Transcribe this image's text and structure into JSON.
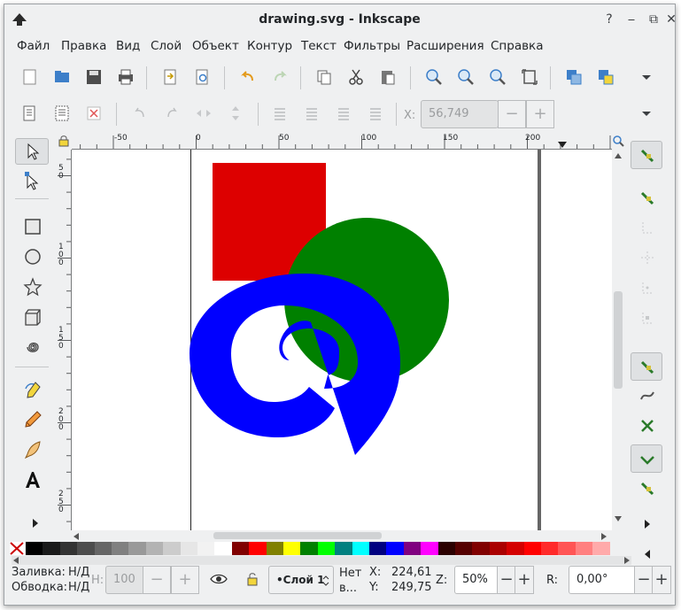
{
  "window": {
    "title": "drawing.svg - Inkscape"
  },
  "menu": [
    "Файл",
    "Правка",
    "Вид",
    "Слой",
    "Объект",
    "Контур",
    "Текст",
    "Фильтры",
    "Расширения",
    "Справка"
  ],
  "toolbar2": {
    "x_label": "X:",
    "x_value": "56,749",
    "minus": "−",
    "plus": "+"
  },
  "ruler": {
    "h_labels": [
      "-50",
      "0",
      "50",
      "100",
      "150",
      "200"
    ]
  },
  "palette": [
    "#000000",
    "#1a1a1a",
    "#333333",
    "#4d4d4d",
    "#666666",
    "#808080",
    "#999999",
    "#b3b3b3",
    "#cccccc",
    "#e6e6e6",
    "#f2f2f2",
    "#ffffff",
    "#800000",
    "#ff0000",
    "#808000",
    "#ffff00",
    "#008000",
    "#00ff00",
    "#008080",
    "#00ffff",
    "#000080",
    "#0000ff",
    "#800080",
    "#ff00ff",
    "#2b0000",
    "#550000",
    "#800000",
    "#aa0000",
    "#d40000",
    "#ff0000",
    "#ff2a2a",
    "#ff5555",
    "#ff8080",
    "#ffaaaa"
  ],
  "statusbar": {
    "fill_label": "Заливка:",
    "fill_value": "Н/Д",
    "stroke_label": "Обводка:",
    "stroke_value": "Н/Д",
    "h_label": "H:",
    "h_value": "100",
    "layer": "•Слой 1",
    "no_selection": "Нет в...",
    "x_label": "X:",
    "x_value": "224,61",
    "y_label": "Y:",
    "y_value": "249,75",
    "z_label": "Z:",
    "zoom": "50%",
    "r_label": "R:",
    "rotation": "0,00°"
  },
  "colors": {
    "rect": "#dd0000",
    "circle": "#008000",
    "spiral": "#0000ff"
  }
}
